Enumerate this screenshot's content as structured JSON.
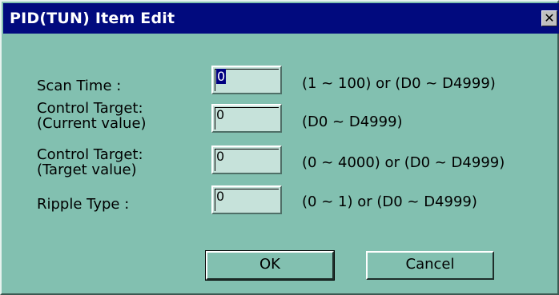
{
  "window": {
    "title": "PID(TUN) Item Edit",
    "close_glyph": "✕"
  },
  "fields": [
    {
      "label_lines": [
        "Scan Time :"
      ],
      "value": "0",
      "range": "(1 ~ 100) or (D0 ~ D4999)"
    },
    {
      "label_lines": [
        "Control Target:",
        "(Current value)"
      ],
      "value": "0",
      "range": "(D0 ~ D4999)"
    },
    {
      "label_lines": [
        "Control Target:",
        "(Target value)"
      ],
      "value": "0",
      "range": "(0 ~ 4000) or (D0 ~ D4999)"
    },
    {
      "label_lines": [
        "Ripple Type :"
      ],
      "value": "0",
      "range": "(0 ~ 1) or (D0 ~ D4999)"
    }
  ],
  "buttons": {
    "ok": "OK",
    "cancel": "Cancel"
  }
}
